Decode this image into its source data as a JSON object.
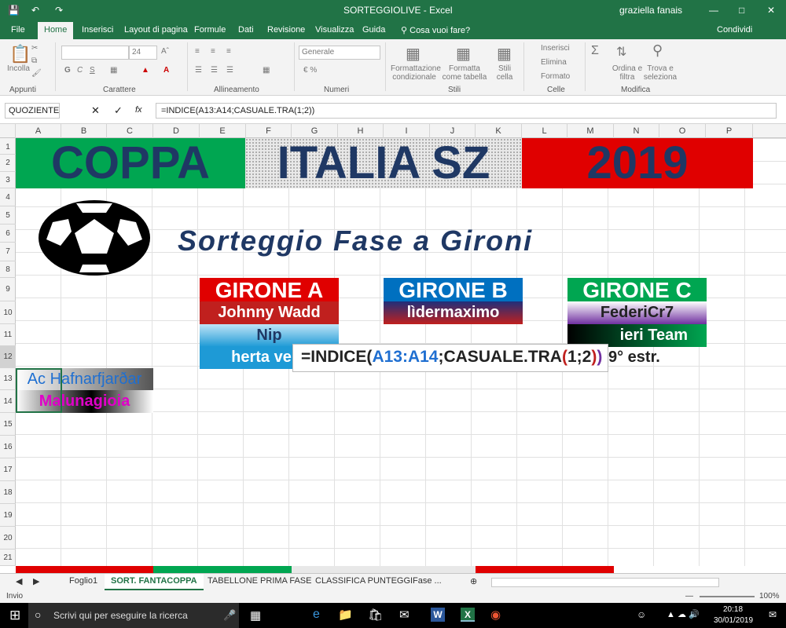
{
  "window": {
    "title": "SORTEGGIOLIVE - Excel",
    "user": "graziella fanais"
  },
  "tabs": {
    "items": [
      "File",
      "Home",
      "Inserisci",
      "Layout di pagina",
      "Formule",
      "Dati",
      "Revisione",
      "Visualizza",
      "Guida",
      "Cosa vuoi fare?"
    ],
    "share": "Condividi"
  },
  "ribbon": {
    "groups": [
      "Appunti",
      "Carattere",
      "Allineamento",
      "Numeri",
      "Stili",
      "Celle",
      "Modifica"
    ],
    "paste": "Incolla",
    "font_size": "24",
    "number_format": "Generale",
    "cond_format": "Formattazione condizionale",
    "format_table": "Formatta come tabella",
    "cell_styles": "Stili cella",
    "insert": "Inserisci",
    "delete": "Elimina",
    "format": "Formato",
    "sort_filter": "Ordina e filtra",
    "find_select": "Trova e seleziona",
    "bold": "G",
    "italic": "C",
    "underline": "S"
  },
  "formula_bar": {
    "name_box": "QUOZIENTE",
    "formula": "=INDICE(A13:A14;CASUALE.TRA(1;2))",
    "fx": "fx"
  },
  "columns": [
    "A",
    "B",
    "C",
    "D",
    "E",
    "F",
    "G",
    "H",
    "I",
    "J",
    "K",
    "L",
    "M",
    "N",
    "O",
    "P"
  ],
  "rows": [
    "1",
    "2",
    "3",
    "4",
    "5",
    "6",
    "7",
    "8",
    "9",
    "10",
    "11",
    "12",
    "13",
    "14",
    "15",
    "16",
    "17",
    "18",
    "19",
    "20",
    "21"
  ],
  "sheet": {
    "banner": [
      "COPPA",
      "ITALIA SZ",
      "2019"
    ],
    "subtitle": "Sorteggio Fase a Gironi",
    "groups": [
      {
        "name": "GIRONE A",
        "teams": [
          "Johnny Wadd",
          "Nip",
          "herta vern"
        ],
        "color": "#e00000"
      },
      {
        "name": "GIRONE B",
        "teams": [
          "lìdermaximo"
        ],
        "color": "#0070c0"
      },
      {
        "name": "GIRONE C",
        "teams": [
          "FederiCr7",
          "ieri Team",
          "9° estr."
        ],
        "color": "#00a651"
      }
    ],
    "pool": [
      "Ac Hafnarfjarðar",
      "Malunagioia"
    ],
    "edit_formula": {
      "eq": "=INDICE(",
      "range": "A13:A14",
      "mid": ";CASUALE.TRA",
      "p1": "(",
      "args": "1;2",
      "p2": ")",
      "p3": ")"
    }
  },
  "sheet_tabs": [
    "Foglio1",
    "SORT. FANTACOPPA",
    "TABELLONE PRIMA FASE",
    "CLASSIFICA PUNTEGGI",
    "Fase ..."
  ],
  "status": {
    "mode": "Invio",
    "zoom": "100%"
  },
  "taskbar": {
    "search": "Scrivi qui per eseguire la ricerca",
    "time": "20:18",
    "date": "30/01/2019"
  }
}
